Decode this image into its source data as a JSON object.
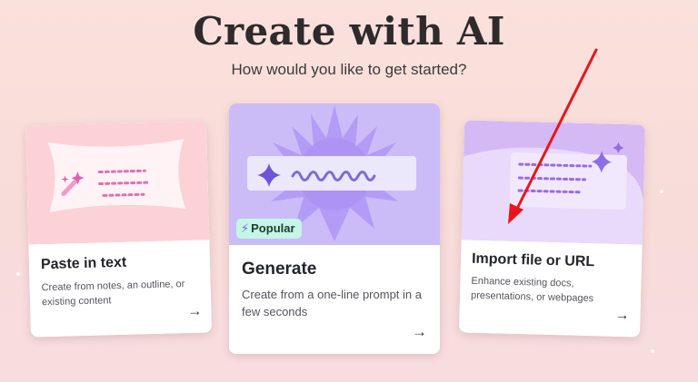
{
  "header": {
    "title": "Create with AI",
    "subtitle": "How would you like to get started?"
  },
  "cards": [
    {
      "title": "Paste in text",
      "description": "Create from notes, an outline, or existing content",
      "arrow": "→"
    },
    {
      "title": "Generate",
      "description": "Create from a one-line prompt in a few seconds",
      "badge": "Popular",
      "arrow": "→"
    },
    {
      "title": "Import file or URL",
      "description": "Enhance existing docs, presentations, or webpages",
      "arrow": "→"
    }
  ],
  "colors": {
    "background": "#fbe1dc",
    "paste_art": "#fcd2d6",
    "generate_art": "#cbbcf7",
    "import_art": "#d5b9f5",
    "badge": "#c4f5e6",
    "annotation": "#e8151c"
  },
  "icons": {
    "paste": "magic-wand-icon",
    "generate": "sparkle-icon",
    "badge": "lightning-icon",
    "import": "sparkle-icon",
    "card_action": "arrow-right-icon"
  }
}
